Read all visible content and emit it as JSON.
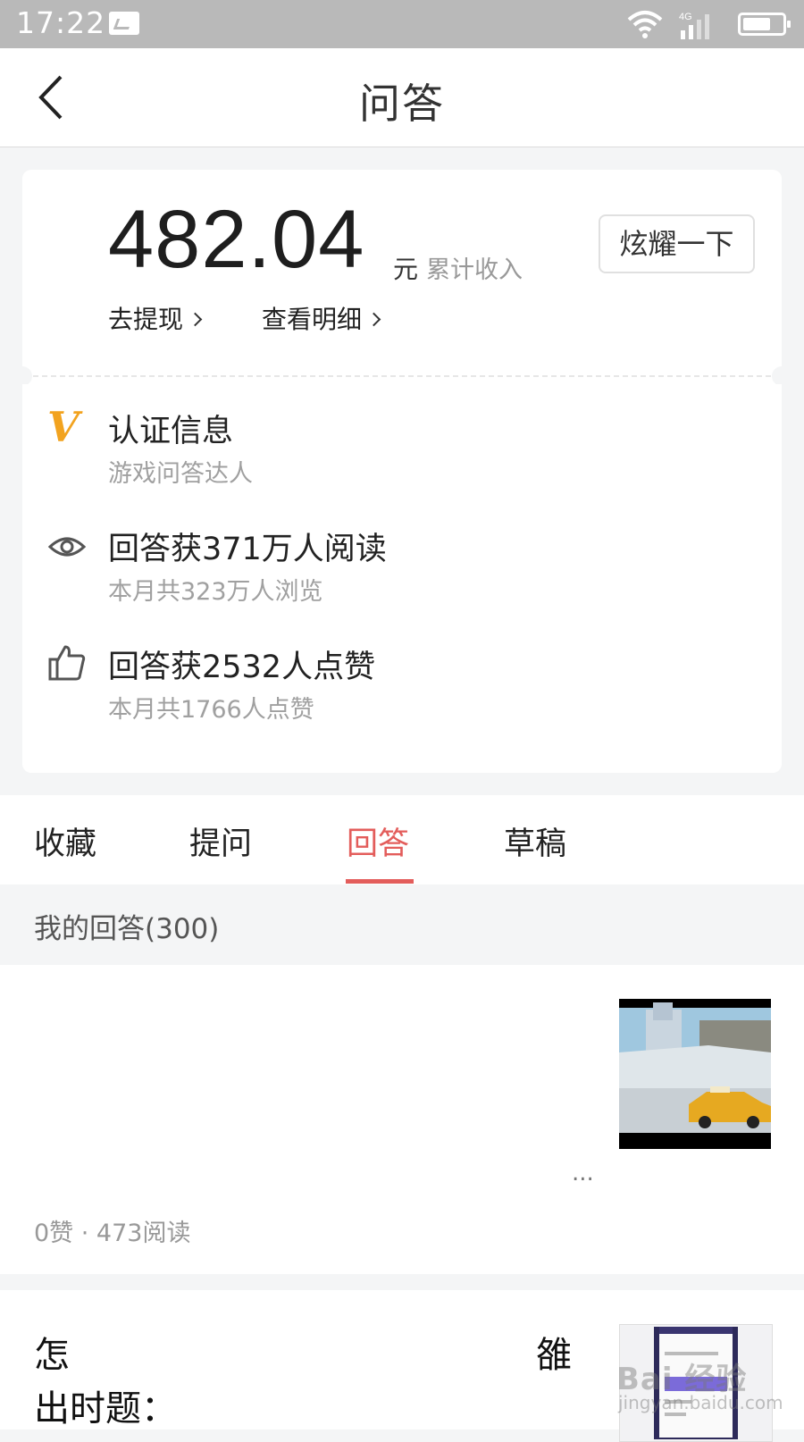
{
  "status_bar": {
    "time": "17:22",
    "network": "4G"
  },
  "nav": {
    "title": "问答"
  },
  "earnings": {
    "amount": "482.04",
    "unit": "元",
    "label": "累计收入",
    "show_off_button": "炫耀一下",
    "withdraw_link": "去提现",
    "details_link": "查看明细"
  },
  "stats": [
    {
      "title": "认证信息",
      "subtitle": "游戏问答达人",
      "icon": "verified-v-icon"
    },
    {
      "title": "回答获371万人阅读",
      "subtitle": "本月共323万人浏览",
      "icon": "eye-icon"
    },
    {
      "title": "回答获2532人点赞",
      "subtitle": "本月共1766人点赞",
      "icon": "thumbs-up-icon"
    }
  ],
  "tabs": [
    {
      "label": "收藏"
    },
    {
      "label": "提问"
    },
    {
      "label": "回答",
      "active": true
    },
    {
      "label": "草稿"
    }
  ],
  "section": {
    "header": "我的回答(300)"
  },
  "feed": [
    {
      "more": "...",
      "meta": "0赞 · 473阅读"
    },
    {
      "text_a": "怎",
      "text_b": "雒",
      "text_c": "出时题："
    }
  ],
  "watermark": {
    "brand": "Bai 经验",
    "url": "jingyan.baidu.com"
  },
  "colors": {
    "accent": "#e35d5b",
    "verified": "#f2a31f",
    "statusbar": "#b9b9b9"
  }
}
